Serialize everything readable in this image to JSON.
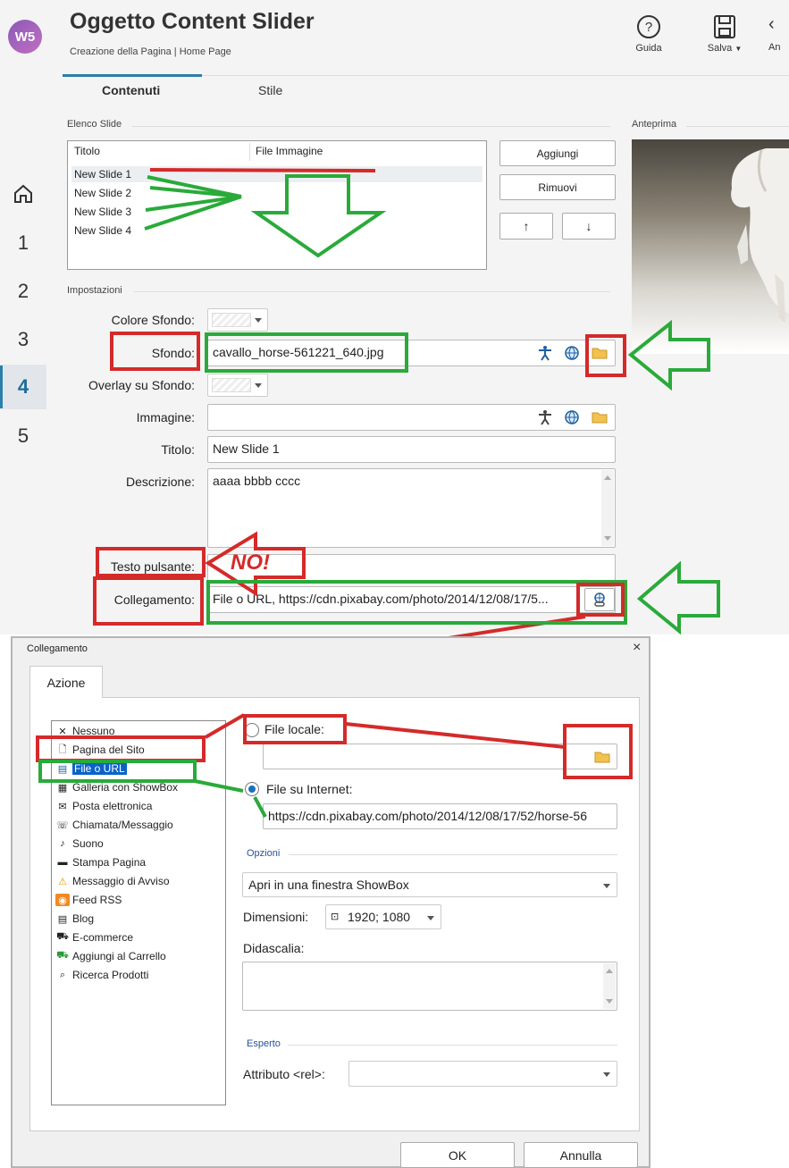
{
  "header": {
    "logo_text": "W5",
    "title": "Oggetto Content Slider",
    "subtitle": "Creazione della Pagina | Home Page",
    "toolbar": {
      "guide_label": "Guida",
      "save_label": "Salva",
      "cut_label": "An"
    }
  },
  "tabs": [
    "Contenuti",
    "Stile"
  ],
  "nav": [
    "1",
    "2",
    "3",
    "4",
    "5"
  ],
  "slides": {
    "section_label": "Elenco Slide",
    "col_title": "Titolo",
    "col_image": "File Immagine",
    "items": [
      "New Slide 1",
      "New Slide 2",
      "New Slide 3",
      "New Slide 4"
    ],
    "add_label": "Aggiungi",
    "remove_label": "Rimuovi",
    "up_label": "↑",
    "down_label": "↓"
  },
  "preview_label": "Anteprima",
  "settings": {
    "section_label": "Impostazioni",
    "bg_color_label": "Colore Sfondo:",
    "bg_label": "Sfondo:",
    "bg_value": "cavallo_horse-561221_640.jpg",
    "overlay_label": "Overlay su Sfondo:",
    "image_label": "Immagine:",
    "image_value": "",
    "title_label": "Titolo:",
    "title_value": "New Slide 1",
    "desc_label": "Descrizione:",
    "desc_value": "aaaa bbbb cccc",
    "button_text_label": "Testo pulsante:",
    "link_label": "Collegamento:",
    "link_value": "File o URL, https://cdn.pixabay.com/photo/2014/12/08/17/5..."
  },
  "annotation": {
    "no_text": "NO!"
  },
  "dialog": {
    "title": "Collegamento",
    "close": "×",
    "tab": "Azione",
    "tree": [
      {
        "label": "Nessuno",
        "icon": "x-icon"
      },
      {
        "label": "Pagina del Sito",
        "icon": "page-icon"
      },
      {
        "label": "File o URL",
        "icon": "file-url-icon"
      },
      {
        "label": "Galleria con ShowBox",
        "icon": "gallery-icon"
      },
      {
        "label": "Posta elettronica",
        "icon": "mail-icon"
      },
      {
        "label": "Chiamata/Messaggio",
        "icon": "phone-icon"
      },
      {
        "label": "Suono",
        "icon": "sound-icon"
      },
      {
        "label": "Stampa Pagina",
        "icon": "print-icon"
      },
      {
        "label": "Messaggio di Avviso",
        "icon": "warning-icon"
      },
      {
        "label": "Feed RSS",
        "icon": "rss-icon"
      },
      {
        "label": "Blog",
        "icon": "blog-icon"
      },
      {
        "label": "E-commerce",
        "icon": "cart-icon"
      },
      {
        "label": "Aggiungi al Carrello",
        "icon": "cart-add-icon"
      },
      {
        "label": "Ricerca Prodotti",
        "icon": "search-product-icon"
      }
    ],
    "local_file_label": "File locale:",
    "local_file_value": "",
    "internet_file_label": "File su Internet:",
    "internet_file_value": "https://cdn.pixabay.com/photo/2014/12/08/17/52/horse-56",
    "options_label": "Opzioni",
    "open_mode": "Apri in una finestra ShowBox",
    "dimensions_label": "Dimensioni:",
    "dimensions_value": "1920; 1080",
    "caption_label": "Didascalia:",
    "caption_value": "",
    "expert_label": "Esperto",
    "rel_label": "Attributo <rel>:",
    "rel_value": "",
    "ok_label": "OK",
    "cancel_label": "Annulla"
  },
  "colors": {
    "accent": "#2b7fa8",
    "annotation_red": "#d42a2a",
    "annotation_green": "#2aaa3a",
    "selection": "#0a62c9"
  }
}
